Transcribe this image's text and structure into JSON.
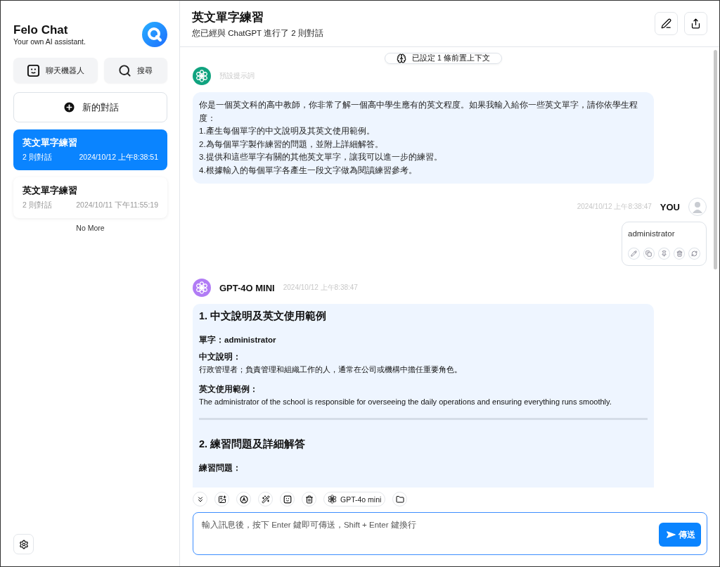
{
  "sidebar": {
    "app_title": "Felo Chat",
    "app_subtitle": "Your own AI assistant.",
    "nav_buttons": [
      {
        "kind": "bot",
        "label": "聊天機器人"
      },
      {
        "kind": "search",
        "label": "搜尋"
      }
    ],
    "new_chat_button": "新的對話",
    "conversations": [
      {
        "title": "英文單字練習",
        "count": "2 則對話",
        "time": "2024/10/12 上午8:38:51",
        "selected": true
      },
      {
        "title": "英文單字練習",
        "count": "2 則對話",
        "time": "2024/10/11 下午11:55:19",
        "selected": false
      }
    ],
    "end_note": "No More"
  },
  "header": {
    "title": "英文單字練習",
    "subtitle": "您已經與 ChatGPT 進行了 2 則對話"
  },
  "context_chip": "已設定 1 條前置上下文",
  "messages": [
    {
      "kind": "prompt",
      "label": "預設提示詞",
      "paragraphs": [
        "你是一個英文科的高中教師，你非常了解一個高中學生應有的英文程度。如果我輸入給你一些英文單字，請你依學生程度：",
        "1.產生每個單字的中文說明及其英文使用範例。",
        "2.為每個單字製作練習的問題，並附上詳細解答。",
        "3.提供和這些單字有關的其他英文單字，讓我可以進一步的練習。",
        "4.根據輸入的每個單字各產生一段文字做為閱讀練習參考。"
      ]
    },
    {
      "kind": "user",
      "name": "YOU",
      "time": "2024/10/12 上午8:38:47",
      "text": "administrator"
    },
    {
      "kind": "assistant",
      "name": "GPT-4O MINI",
      "time": "2024/10/12 上午8:38:47",
      "blocks": [
        {
          "kind": "heading",
          "text": "1. 中文說明及英文使用範例"
        },
        {
          "kind": "label",
          "text": "單字：administrator"
        },
        {
          "kind": "label",
          "text": "中文說明："
        },
        {
          "kind": "text",
          "text": "行政管理者；負責管理和組織工作的人，通常在公司或機構中擔任重要角色。"
        },
        {
          "kind": "label",
          "text": "英文使用範例："
        },
        {
          "kind": "text",
          "text": "The administrator of the school is responsible for overseeing the daily operations and ensuring everything runs smoothly."
        },
        {
          "kind": "divider"
        },
        {
          "kind": "heading",
          "text": "2. 練習問題及詳細解答"
        },
        {
          "kind": "label",
          "text": "練習問題："
        }
      ]
    }
  ],
  "toolbar": {
    "model": "GPT-4o mini"
  },
  "composer": {
    "placeholder": "輸入訊息後，按下 Enter 鍵即可傳送，Shift + Enter 鍵換行",
    "send_button": "傳送"
  }
}
